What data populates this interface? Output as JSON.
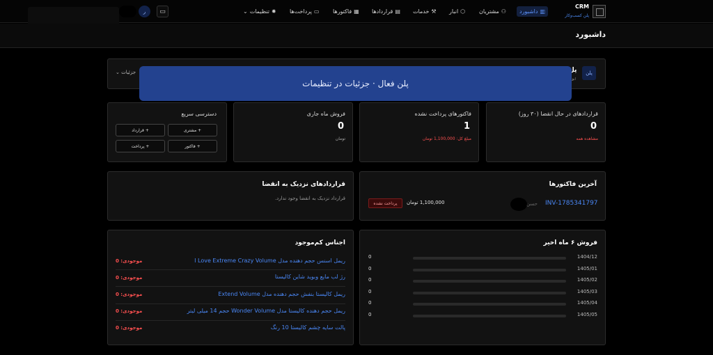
{
  "app": {
    "name": "CRM",
    "subtitle": "پلن کسب‌وکار"
  },
  "nav": [
    {
      "label": "داشبورد",
      "icon": "chart-icon",
      "active": true
    },
    {
      "label": "مشتریان",
      "icon": "users-icon"
    },
    {
      "label": "انبار",
      "icon": "box-icon"
    },
    {
      "label": "خدمات",
      "icon": "wrench-icon"
    },
    {
      "label": "قراردادها",
      "icon": "document-icon"
    },
    {
      "label": "فاکتورها",
      "icon": "receipt-icon"
    },
    {
      "label": "پرداخت‌ها",
      "icon": "card-icon"
    },
    {
      "label": "تنظیمات",
      "icon": "gear-icon"
    }
  ],
  "header": {
    "avatar_letter": "ر",
    "monitor_icon": "monitor-icon"
  },
  "page": {
    "title": "داشبورد"
  },
  "plan": {
    "badge": "پلن",
    "title": "پل",
    "sub": "انق",
    "details_label": "جزئیات",
    "toast": "پلن فعال · جزئیات در تنظیمات"
  },
  "stats": [
    {
      "title": "قراردادهای در حال انقضا (۳۰ روز)",
      "value": "0",
      "note": "مشاهده همه",
      "note_color": "red"
    },
    {
      "title": "فاکتورهای پرداخت نشده",
      "value": "1",
      "note": "مبلغ کل: 1,100,000 تومان",
      "note_color": "red"
    },
    {
      "title": "فروش ماه جاری",
      "value": "0",
      "note": "تومان",
      "note_color": "muted"
    }
  ],
  "quick_access": {
    "title": "دسترسی سریع",
    "buttons": [
      "+ مشتری",
      "+ قرارداد",
      "+ فاکتور",
      "+ پرداخت"
    ]
  },
  "latest_invoices": {
    "title": "آخرین فاکتورها",
    "rows": [
      {
        "id": "INV-1785341797",
        "customer": "حسن",
        "amount": "1,100,000 تومان",
        "status": "پرداخت نشده"
      }
    ]
  },
  "expiring_contracts": {
    "title": "قراردادهای نزدیک به انقضا",
    "empty": "قرارداد نزدیک به انقضا وجود ندارد."
  },
  "sales_chart": {
    "title": "فروش ۶ ماه اخیر"
  },
  "chart_data": {
    "type": "bar",
    "title": "فروش ۶ ماه اخیر",
    "categories": [
      "1404/12",
      "1405/01",
      "1405/02",
      "1405/03",
      "1405/04",
      "1405/05"
    ],
    "values": [
      0,
      0,
      0,
      0,
      0,
      0
    ],
    "orientation": "horizontal"
  },
  "low_stock": {
    "title": "اجناس کم‌موجود",
    "items": [
      {
        "name": "ریمل اسنس حجم دهنده مدل I Love Extreme Crazy Volume",
        "stock": "موجودی: 0"
      },
      {
        "name": "رژ لب مایع وبوید شاین کالیستا",
        "stock": "موجودی: 0"
      },
      {
        "name": "ریمل کالیستا بنفش حجم دهنده مدل Extend Volume",
        "stock": "موجودی: 0"
      },
      {
        "name": "ریمل حجم دهنده کالیستا مدل Wonder Volume حجم 14 میلی لیتر",
        "stock": "موجودی: 0"
      },
      {
        "name": "پالت سایه چشم کالیستا 10 رنگ",
        "stock": "موجودی: 0"
      }
    ]
  }
}
